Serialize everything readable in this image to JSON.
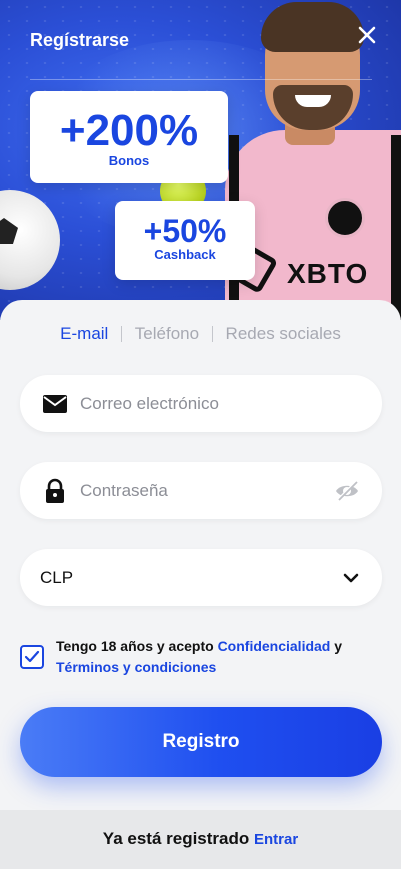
{
  "header": {
    "title": "Regístrarse",
    "close_icon": "close-icon"
  },
  "bonuses": [
    {
      "amount": "+200%",
      "label": "Bonos"
    },
    {
      "amount": "+50%",
      "label": "Cashback"
    }
  ],
  "hero": {
    "sponsor_text": "XBTO"
  },
  "tabs": [
    {
      "label": "E-mail",
      "active": true
    },
    {
      "label": "Teléfono",
      "active": false
    },
    {
      "label": "Redes sociales",
      "active": false
    }
  ],
  "form": {
    "email": {
      "placeholder": "Correo electrónico",
      "value": "",
      "icon": "mail-icon"
    },
    "password": {
      "placeholder": "Contraseña",
      "value": "",
      "icon": "lock-icon",
      "toggle_icon": "eye-off-icon"
    },
    "currency": {
      "value": "CLP",
      "icon": "chevron-down-icon"
    },
    "terms": {
      "checked": true,
      "prefix": "Tengo 18 años y acepto",
      "privacy_link": "Confidencialidad",
      "conjunction": "y",
      "terms_link": "Términos y condiciones"
    },
    "submit_label": "Registro"
  },
  "footer": {
    "text": "Ya está registrado",
    "link": "Entrar"
  },
  "colors": {
    "accent": "#1a46e0",
    "hero_bg": "#2b4fd6",
    "page_bg": "#f3f4f6",
    "footer_bg": "#e7e8ea"
  }
}
